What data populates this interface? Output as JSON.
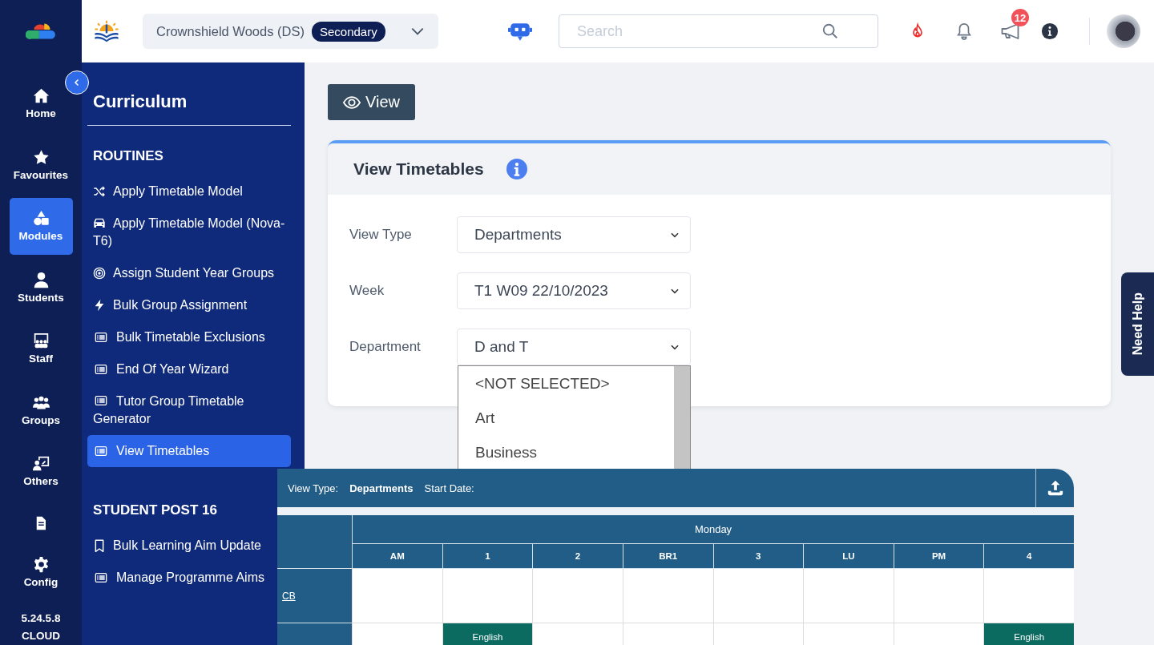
{
  "rail": {
    "items": [
      {
        "label": "Home",
        "selected": false
      },
      {
        "label": "Favourites",
        "selected": false
      },
      {
        "label": "Modules",
        "selected": true
      },
      {
        "label": "Students",
        "selected": false
      },
      {
        "label": "Staff",
        "selected": false
      },
      {
        "label": "Groups",
        "selected": false
      },
      {
        "label": "Others",
        "selected": false
      },
      {
        "selected": false
      },
      {
        "label": "Config",
        "selected": false
      }
    ],
    "version": "5.24.5.8",
    "edition": "CLOUD"
  },
  "header": {
    "school": "Crownshield Woods (DS)",
    "phase": "Secondary",
    "search": {
      "placeholder": "Search"
    },
    "announcement_count": "12"
  },
  "sidebar": {
    "title": "Curriculum",
    "sections": [
      {
        "heading": "ROUTINES",
        "items": [
          {
            "label": "Apply Timetable Model",
            "selected": false
          },
          {
            "label": "Apply Timetable Model (Nova-T6)",
            "selected": false
          },
          {
            "label": "Assign Student Year Groups",
            "selected": false
          },
          {
            "label": "Bulk Group Assignment",
            "selected": false
          },
          {
            "label": "Bulk Timetable Exclusions",
            "selected": false
          },
          {
            "label": "End Of Year Wizard",
            "selected": false
          },
          {
            "label": "Tutor Group Timetable Generator",
            "selected": false
          },
          {
            "label": "View Timetables",
            "selected": true
          }
        ]
      },
      {
        "heading": "STUDENT POST 16",
        "items": [
          {
            "label": "Bulk Learning Aim Update",
            "selected": false
          },
          {
            "label": "Manage Programme Aims",
            "selected": false
          }
        ]
      }
    ]
  },
  "view_button": "View",
  "card": {
    "title": "View Timetables",
    "fields": [
      {
        "label": "View Type",
        "value": "Departments",
        "expanded": false
      },
      {
        "label": "Week",
        "value": "T1 W09 22/10/2023",
        "expanded": false
      },
      {
        "label": "Department",
        "value": "D and T",
        "expanded": true,
        "options": [
          "<NOT SELECTED>",
          "Art",
          "Business"
        ]
      }
    ]
  },
  "need_help": "Need Help",
  "timetable": {
    "view_type_label": "View Type:",
    "view_type": "Departments",
    "start_date_label": "Start Date:",
    "day": "Monday",
    "periods": [
      "AM",
      "1",
      "2",
      "BR1",
      "3",
      "LU",
      "PM",
      "4"
    ],
    "rows": [
      {
        "label": "CB",
        "cells": [
          null,
          null,
          null,
          null,
          null,
          null,
          null,
          null
        ]
      },
      {
        "cells": [
          null,
          "English",
          null,
          null,
          null,
          null,
          null,
          "English"
        ]
      }
    ]
  }
}
